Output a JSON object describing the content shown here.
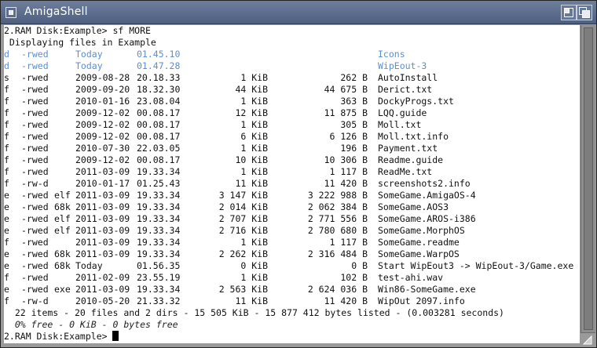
{
  "window": {
    "title": "AmigaShell",
    "close_icon": "close-gadget-icon",
    "zoom_icon": "zoom-gadget-icon",
    "depth_icon": "depth-gadget-icon"
  },
  "console": {
    "command_line": "2.RAM Disk:Example> sf MORE",
    "header": " Displaying files in Example",
    "entries": [
      {
        "type": "d",
        "prot": "-rwed",
        "arch": "",
        "date": "Today",
        "time": "01.45.10",
        "size1": "",
        "size2": "",
        "name": "Icons",
        "is_dir": true
      },
      {
        "type": "d",
        "prot": "-rwed",
        "arch": "",
        "date": "Today",
        "time": "01.47.28",
        "size1": "",
        "size2": "",
        "name": "WipEout-3",
        "is_dir": true
      },
      {
        "type": "s",
        "prot": "-rwed",
        "arch": "",
        "date": "2009-08-28",
        "time": "20.18.33",
        "size1": "1 KiB",
        "size2": "262 B",
        "name": "AutoInstall",
        "is_dir": false
      },
      {
        "type": "f",
        "prot": "-rwed",
        "arch": "",
        "date": "2009-09-20",
        "time": "18.32.30",
        "size1": "44 KiB",
        "size2": "44 675 B",
        "name": "Derict.txt",
        "is_dir": false
      },
      {
        "type": "f",
        "prot": "-rwed",
        "arch": "",
        "date": "2010-01-16",
        "time": "23.08.04",
        "size1": "1 KiB",
        "size2": "363 B",
        "name": "DockyProgs.txt",
        "is_dir": false
      },
      {
        "type": "f",
        "prot": "-rwed",
        "arch": "",
        "date": "2009-12-02",
        "time": "00.08.17",
        "size1": "12 KiB",
        "size2": "11 875 B",
        "name": "LQQ.guide",
        "is_dir": false
      },
      {
        "type": "f",
        "prot": "-rwed",
        "arch": "",
        "date": "2009-12-02",
        "time": "00.08.17",
        "size1": "1 KiB",
        "size2": "305 B",
        "name": "Moll.txt",
        "is_dir": false
      },
      {
        "type": "f",
        "prot": "-rwed",
        "arch": "",
        "date": "2009-12-02",
        "time": "00.08.17",
        "size1": "6 KiB",
        "size2": "6 126 B",
        "name": "Moll.txt.info",
        "is_dir": false
      },
      {
        "type": "f",
        "prot": "-rwed",
        "arch": "",
        "date": "2010-07-30",
        "time": "22.03.05",
        "size1": "1 KiB",
        "size2": "196 B",
        "name": "Payment.txt",
        "is_dir": false
      },
      {
        "type": "f",
        "prot": "-rwed",
        "arch": "",
        "date": "2009-12-02",
        "time": "00.08.17",
        "size1": "10 KiB",
        "size2": "10 306 B",
        "name": "Readme.guide",
        "is_dir": false
      },
      {
        "type": "f",
        "prot": "-rwed",
        "arch": "",
        "date": "2011-03-09",
        "time": "19.33.34",
        "size1": "1 KiB",
        "size2": "1 117 B",
        "name": "ReadMe.txt",
        "is_dir": false
      },
      {
        "type": "f",
        "prot": "-rw-d",
        "arch": "",
        "date": "2010-01-17",
        "time": "01.25.43",
        "size1": "11 KiB",
        "size2": "11 420 B",
        "name": "screenshots2.info",
        "is_dir": false
      },
      {
        "type": "e",
        "prot": "-rwed",
        "arch": "elf",
        "date": "2011-03-09",
        "time": "19.33.34",
        "size1": "3 147 KiB",
        "size2": "3 222 988 B",
        "name": "SomeGame.AmigaOS-4",
        "is_dir": false
      },
      {
        "type": "e",
        "prot": "-rwed",
        "arch": "68k",
        "date": "2011-03-09",
        "time": "19.33.34",
        "size1": "2 014 KiB",
        "size2": "2 062 384 B",
        "name": "SomeGame.AOS3",
        "is_dir": false
      },
      {
        "type": "e",
        "prot": "-rwed",
        "arch": "elf",
        "date": "2011-03-09",
        "time": "19.33.34",
        "size1": "2 707 KiB",
        "size2": "2 771 556 B",
        "name": "SomeGame.AROS-i386",
        "is_dir": false
      },
      {
        "type": "e",
        "prot": "-rwed",
        "arch": "elf",
        "date": "2011-03-09",
        "time": "19.33.34",
        "size1": "2 716 KiB",
        "size2": "2 780 680 B",
        "name": "SomeGame.MorphOS",
        "is_dir": false
      },
      {
        "type": "f",
        "prot": "-rwed",
        "arch": "",
        "date": "2011-03-09",
        "time": "19.33.34",
        "size1": "1 KiB",
        "size2": "1 117 B",
        "name": "SomeGame.readme",
        "is_dir": false
      },
      {
        "type": "e",
        "prot": "-rwed",
        "arch": "68k",
        "date": "2011-03-09",
        "time": "19.33.34",
        "size1": "2 262 KiB",
        "size2": "2 316 484 B",
        "name": "SomeGame.WarpOS",
        "is_dir": false
      },
      {
        "type": "e",
        "prot": "-rwed",
        "arch": "68k",
        "date": "Today",
        "time": "01.56.35",
        "size1": "0 KiB",
        "size2": "0 B",
        "name": "Start WipEout3 -> WipEout-3/Game.exe",
        "is_dir": false
      },
      {
        "type": "f",
        "prot": "-rwed",
        "arch": "",
        "date": "2011-02-09",
        "time": "23.55.19",
        "size1": "1 KiB",
        "size2": "102 B",
        "name": "test-ahi.wav",
        "is_dir": false
      },
      {
        "type": "e",
        "prot": "-rwed",
        "arch": "exe",
        "date": "2011-03-09",
        "time": "19.33.34",
        "size1": "2 563 KiB",
        "size2": "2 624 036 B",
        "name": "Win86-SomeGame.exe",
        "is_dir": false
      },
      {
        "type": "f",
        "prot": "-rw-d",
        "arch": "",
        "date": "2010-05-20",
        "time": "21.33.32",
        "size1": "11 KiB",
        "size2": "11 420 B",
        "name": "WipOut 2097.info",
        "is_dir": false
      }
    ],
    "summary": "  22 items - 20 files and 2 dirs - 15 505 KiB - 15 877 412 bytes listed - (0.003281 seconds)",
    "free_line": "  0% free - 0 KiB - 0 bytes free",
    "prompt": "2.RAM Disk:Example> "
  },
  "colors": {
    "title_bar": "#5d6d8d",
    "dir_text": "#5a8fcf",
    "console_bg": "#ffffff",
    "frame": "#9a9a9a"
  }
}
